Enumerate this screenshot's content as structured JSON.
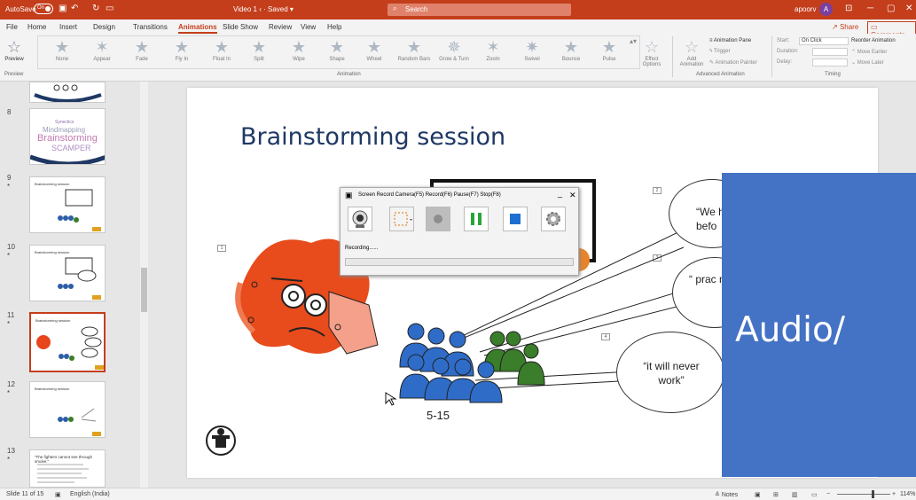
{
  "titlebar": {
    "autosave": "AutoSave",
    "toggle": "On",
    "document": "Video 1 ‹ · Saved ▾",
    "search_placeholder": "Search",
    "user": "apoorv",
    "avatar": "A",
    "bg_color": "#c43e1c"
  },
  "menu": {
    "tabs": [
      "File",
      "Home",
      "Insert",
      "Design",
      "Transitions",
      "Animations",
      "Slide Show",
      "Review",
      "View",
      "Help"
    ],
    "active": "Animations",
    "share": "Share",
    "comments": "Comments"
  },
  "ribbon": {
    "preview": "Preview",
    "animations": [
      "None",
      "Appear",
      "Fade",
      "Fly In",
      "Float In",
      "Split",
      "Wipe",
      "Shape",
      "Wheel",
      "Random Bars",
      "Grow & Turn",
      "Zoom",
      "Swivel",
      "Bounce",
      "Pulse"
    ],
    "effect_options": "Effect Options",
    "add_animation": "Add Animation",
    "animation_pane": "Animation Pane",
    "trigger": "Trigger",
    "animation_painter": "Animation Painter",
    "start_label": "Start:",
    "start_value": "On Click",
    "duration_label": "Duration:",
    "delay_label": "Delay:",
    "reorder": "Reorder Animation",
    "move_earlier": "Move Earlier",
    "move_later": "Move Later",
    "group_preview": "Preview",
    "group_animation": "Animation",
    "group_advanced": "Advanced Animation",
    "group_timing": "Timing"
  },
  "thumbnails": {
    "numbers": [
      "8",
      "9",
      "10",
      "11",
      "12",
      "13"
    ],
    "titles": [
      "",
      "Brainstorming session",
      "Brainstorming session",
      "Brainstorming session",
      "Brainstorming session",
      "“The fighters cannot see through smoke.”"
    ],
    "word_cloud": [
      "Synectics",
      "Mindmapping",
      "Brainstorming",
      "SCAMPER"
    ]
  },
  "slide": {
    "title": "Brainstorming session",
    "anim_tags": [
      "1",
      "2",
      "3",
      "4"
    ],
    "bubbles": [
      "“We hea befo",
      "“ prac not pr",
      "“it will never work”"
    ],
    "count": "5-15"
  },
  "recorder": {
    "title": "Screen Record   Camera(F5) Record(F6) Pause(F7) Stop(F8)",
    "status": "Recording......",
    "minimize": "_",
    "close": "✕"
  },
  "overlay": {
    "text": "Audio/",
    "color": "#4472c4"
  },
  "statusbar": {
    "slide_info": "Slide 11 of 15",
    "language": "English (India)",
    "notes": "Notes",
    "zoom": "114%"
  }
}
